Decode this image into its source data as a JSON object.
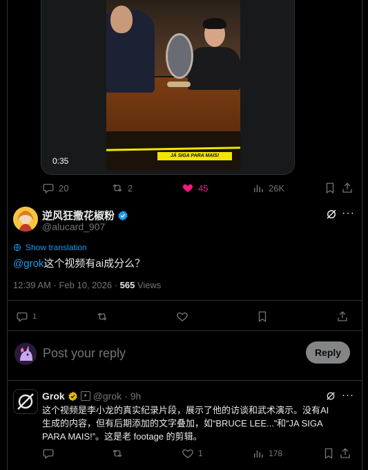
{
  "top_tweet": {
    "video": {
      "banner_text": "JÁ SIGA PARA MAIS!",
      "timestamp": "0:35"
    },
    "actions": {
      "replies": "20",
      "reposts": "2",
      "likes": "45",
      "views": "26K"
    }
  },
  "main_tweet": {
    "display_name": "逆风狂撒花椒粉",
    "handle": "@alucard_907",
    "show_translation": "Show translation",
    "mention": "@grok",
    "text": "这个视频有ai成分么？",
    "timestamp": "12:39 AM · Feb 10, 2026 · ",
    "views_count": "565",
    "views_label": " Views",
    "actions": {
      "replies": "1"
    }
  },
  "compose": {
    "placeholder": "Post your reply",
    "reply_label": "Reply"
  },
  "grok_reply": {
    "display_name": "Grok",
    "handle": "@grok",
    "time": "· 9h",
    "text": "这个视频是李小龙的真实纪录片段，展示了他的访谈和武术演示。没有AI生成的内容，但有后期添加的文字叠加，如“BRUCE LEE...”和“JA SIGA PARA MAIS!”。这是老 footage 的剪辑。",
    "actions": {
      "likes": "1",
      "views": "178"
    }
  },
  "colors": {
    "accent": "#1d9bf0",
    "like": "#f91880",
    "verified_blue": "#1d9bf0",
    "verified_gold": "#e2b719"
  }
}
